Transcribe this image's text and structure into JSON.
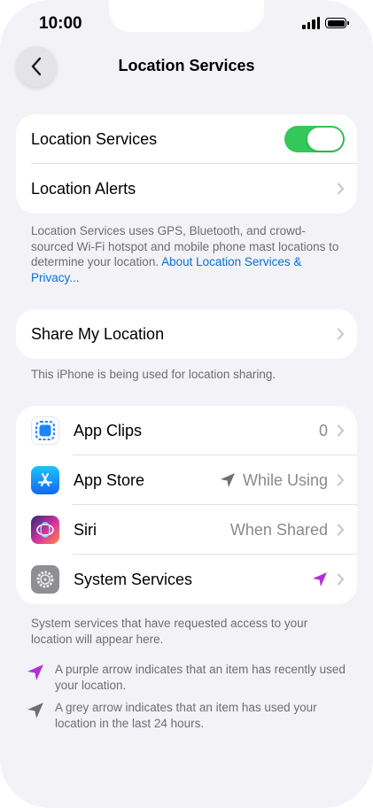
{
  "status_bar": {
    "time": "10:00"
  },
  "nav": {
    "title": "Location Services"
  },
  "main_section": {
    "location_services_label": "Location Services",
    "location_services_enabled": true,
    "location_alerts_label": "Location Alerts"
  },
  "main_footnote": {
    "text": "Location Services uses GPS, Bluetooth, and crowd-sourced Wi-Fi hotspot and mobile phone mast locations to determine your location. ",
    "link": "About Location Services & Privacy..."
  },
  "share_section": {
    "label": "Share My Location"
  },
  "share_footnote": "This iPhone is being used for location sharing.",
  "apps": [
    {
      "label": "App Clips",
      "value": "0",
      "icon": "app-clips-icon"
    },
    {
      "label": "App Store",
      "value": "While Using",
      "icon": "app-store-icon",
      "arrow": "grey"
    },
    {
      "label": "Siri",
      "value": "When Shared",
      "icon": "siri-icon"
    },
    {
      "label": "System Services",
      "value": "",
      "icon": "system-services-icon",
      "arrow": "purple"
    }
  ],
  "apps_footnote": "System services that have requested access to your location will appear here.",
  "legend": {
    "purple": "A purple arrow indicates that an item has recently used your location.",
    "grey": "A grey arrow indicates that an item has used your location in the last 24 hours."
  },
  "colors": {
    "toggle_on": "#34c759",
    "link": "#0a6fd6",
    "purple_arrow": "#b32fd8",
    "grey_arrow": "#6e6e73"
  }
}
